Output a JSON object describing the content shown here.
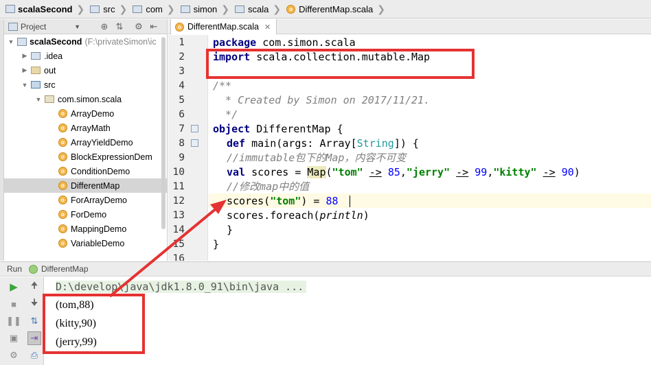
{
  "breadcrumb": [
    {
      "label": "scalaSecond",
      "icon": "project-icon",
      "bold": true
    },
    {
      "label": "src",
      "icon": "folder-icon"
    },
    {
      "label": "com",
      "icon": "folder-icon"
    },
    {
      "label": "simon",
      "icon": "folder-icon"
    },
    {
      "label": "scala",
      "icon": "folder-icon"
    },
    {
      "label": "DifferentMap.scala",
      "icon": "scala-object-icon"
    }
  ],
  "project": {
    "view_label": "Project",
    "tree": [
      {
        "label": "scalaSecond",
        "note": "(F:\\privateSimon\\ic",
        "arrow": "down",
        "indent": 0,
        "icon": "project-icon",
        "bold": true
      },
      {
        "label": ".idea",
        "arrow": "right",
        "indent": 1,
        "icon": "folder-icon"
      },
      {
        "label": "out",
        "arrow": "right",
        "indent": 1,
        "icon": "folder-orange-icon"
      },
      {
        "label": "src",
        "arrow": "down",
        "indent": 1,
        "icon": "folder-blue-icon"
      },
      {
        "label": "com.simon.scala",
        "arrow": "down",
        "indent": 2,
        "icon": "package-icon"
      },
      {
        "label": "ArrayDemo",
        "indent": 3,
        "icon": "scala-object-icon"
      },
      {
        "label": "ArrayMath",
        "indent": 3,
        "icon": "scala-object-icon"
      },
      {
        "label": "ArrayYieldDemo",
        "indent": 3,
        "icon": "scala-object-icon"
      },
      {
        "label": "BlockExpressionDem",
        "indent": 3,
        "icon": "scala-object-icon"
      },
      {
        "label": "ConditionDemo",
        "indent": 3,
        "icon": "scala-object-icon"
      },
      {
        "label": "DifferentMap",
        "indent": 3,
        "icon": "scala-object-icon",
        "selected": true
      },
      {
        "label": "ForArrayDemo",
        "indent": 3,
        "icon": "scala-object-icon"
      },
      {
        "label": "ForDemo",
        "indent": 3,
        "icon": "scala-object-icon"
      },
      {
        "label": "MappingDemo",
        "indent": 3,
        "icon": "scala-object-icon"
      },
      {
        "label": "VariableDemo",
        "indent": 3,
        "icon": "scala-object-icon"
      }
    ]
  },
  "editor": {
    "tab_label": "DifferentMap.scala",
    "line_numbers": [
      "1",
      "2",
      "3",
      "4",
      "5",
      "6",
      "7",
      "8",
      "9",
      "10",
      "11",
      "12",
      "13",
      "14",
      "15",
      "16"
    ],
    "lines": {
      "l1_kw": "package",
      "l1_rest": " com.simon.scala",
      "l2_kw": "import",
      "l2_rest": " scala.collection.mutable.Map",
      "l4": "/**",
      "l5": "  * Created by Simon on 2017/11/21.",
      "l6": "  */",
      "l7_kw": "object",
      "l7_rest": " DifferentMap {",
      "l8_kw": "def",
      "l8_a": " main(args: Array[",
      "l8_type": "String",
      "l8_b": "]) {",
      "l9": "//immutable包下的Map，内容不可变",
      "l10_kw": "val",
      "l10_a": " scores = ",
      "l10_map": "Map",
      "l10_b": "(",
      "l10_s1": "\"tom\"",
      "l10_op1": "->",
      "l10_n1": "85",
      "l10_s2": "\"jerry\"",
      "l10_op2": "->",
      "l10_n2": "99",
      "l10_s3": "\"kitty\"",
      "l10_op3": "->",
      "l10_n3": "90",
      "l11": "//修改map中的值",
      "l12_a": "scores(",
      "l12_s": "\"tom\"",
      "l12_b": ") = ",
      "l12_n": "88",
      "l13_a": "scores.foreach(",
      "l13_fn": "println",
      "l13_b": ")",
      "l14": "}",
      "l15": "}"
    }
  },
  "run": {
    "title": "Run",
    "config": "DifferentMap",
    "command": "D:\\develop\\java\\jdk1.8.0_91\\bin\\java ...",
    "output": [
      "(tom,88)",
      "(kitty,90)",
      "(jerry,99)"
    ]
  },
  "colors": {
    "annotation": "#e53232",
    "keyword": "#000080",
    "string": "#008000",
    "number": "#0000ff",
    "comment": "#808080"
  }
}
